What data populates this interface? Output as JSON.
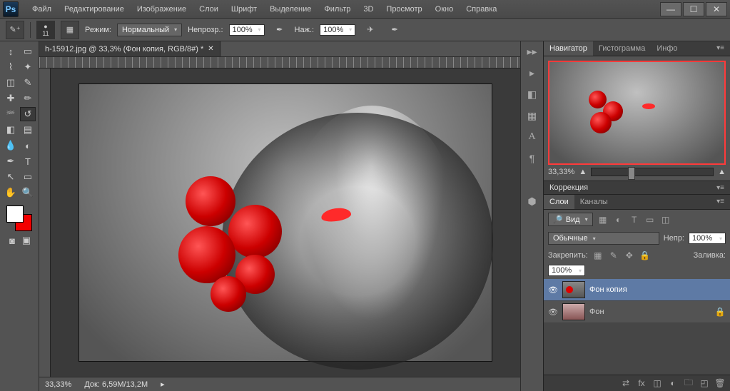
{
  "app": {
    "logo": "Ps"
  },
  "menu": [
    "Файл",
    "Редактирование",
    "Изображение",
    "Слои",
    "Шрифт",
    "Выделение",
    "Фильтр",
    "3D",
    "Просмотр",
    "Окно",
    "Справка"
  ],
  "options": {
    "brush_size": "11",
    "mode_label": "Режим:",
    "mode_value": "Нормальный",
    "opacity_label": "Непрозр.:",
    "opacity_value": "100%",
    "flow_label": "Наж.:",
    "flow_value": "100%"
  },
  "doc": {
    "tab_title": "h-15912.jpg @ 33,3% (Фон копия, RGB/8#) *"
  },
  "status": {
    "zoom": "33,33%",
    "doc_label": "Док:",
    "doc_value": "6,59M/13,2M"
  },
  "panels": {
    "nav_tabs": [
      "Навигатор",
      "Гистограмма",
      "Инфо"
    ],
    "nav_zoom": "33,33%",
    "corrections_title": "Коррекция",
    "layers_tabs": [
      "Слои",
      "Каналы"
    ],
    "layers": {
      "kind_label": "Вид",
      "blend_mode": "Обычные",
      "opacity_label": "Непр:",
      "opacity_value": "100%",
      "lock_label": "Закрепить:",
      "fill_label": "Заливка:",
      "fill_value": "100%",
      "items": [
        {
          "name": "Фон копия"
        },
        {
          "name": "Фон"
        }
      ]
    }
  }
}
